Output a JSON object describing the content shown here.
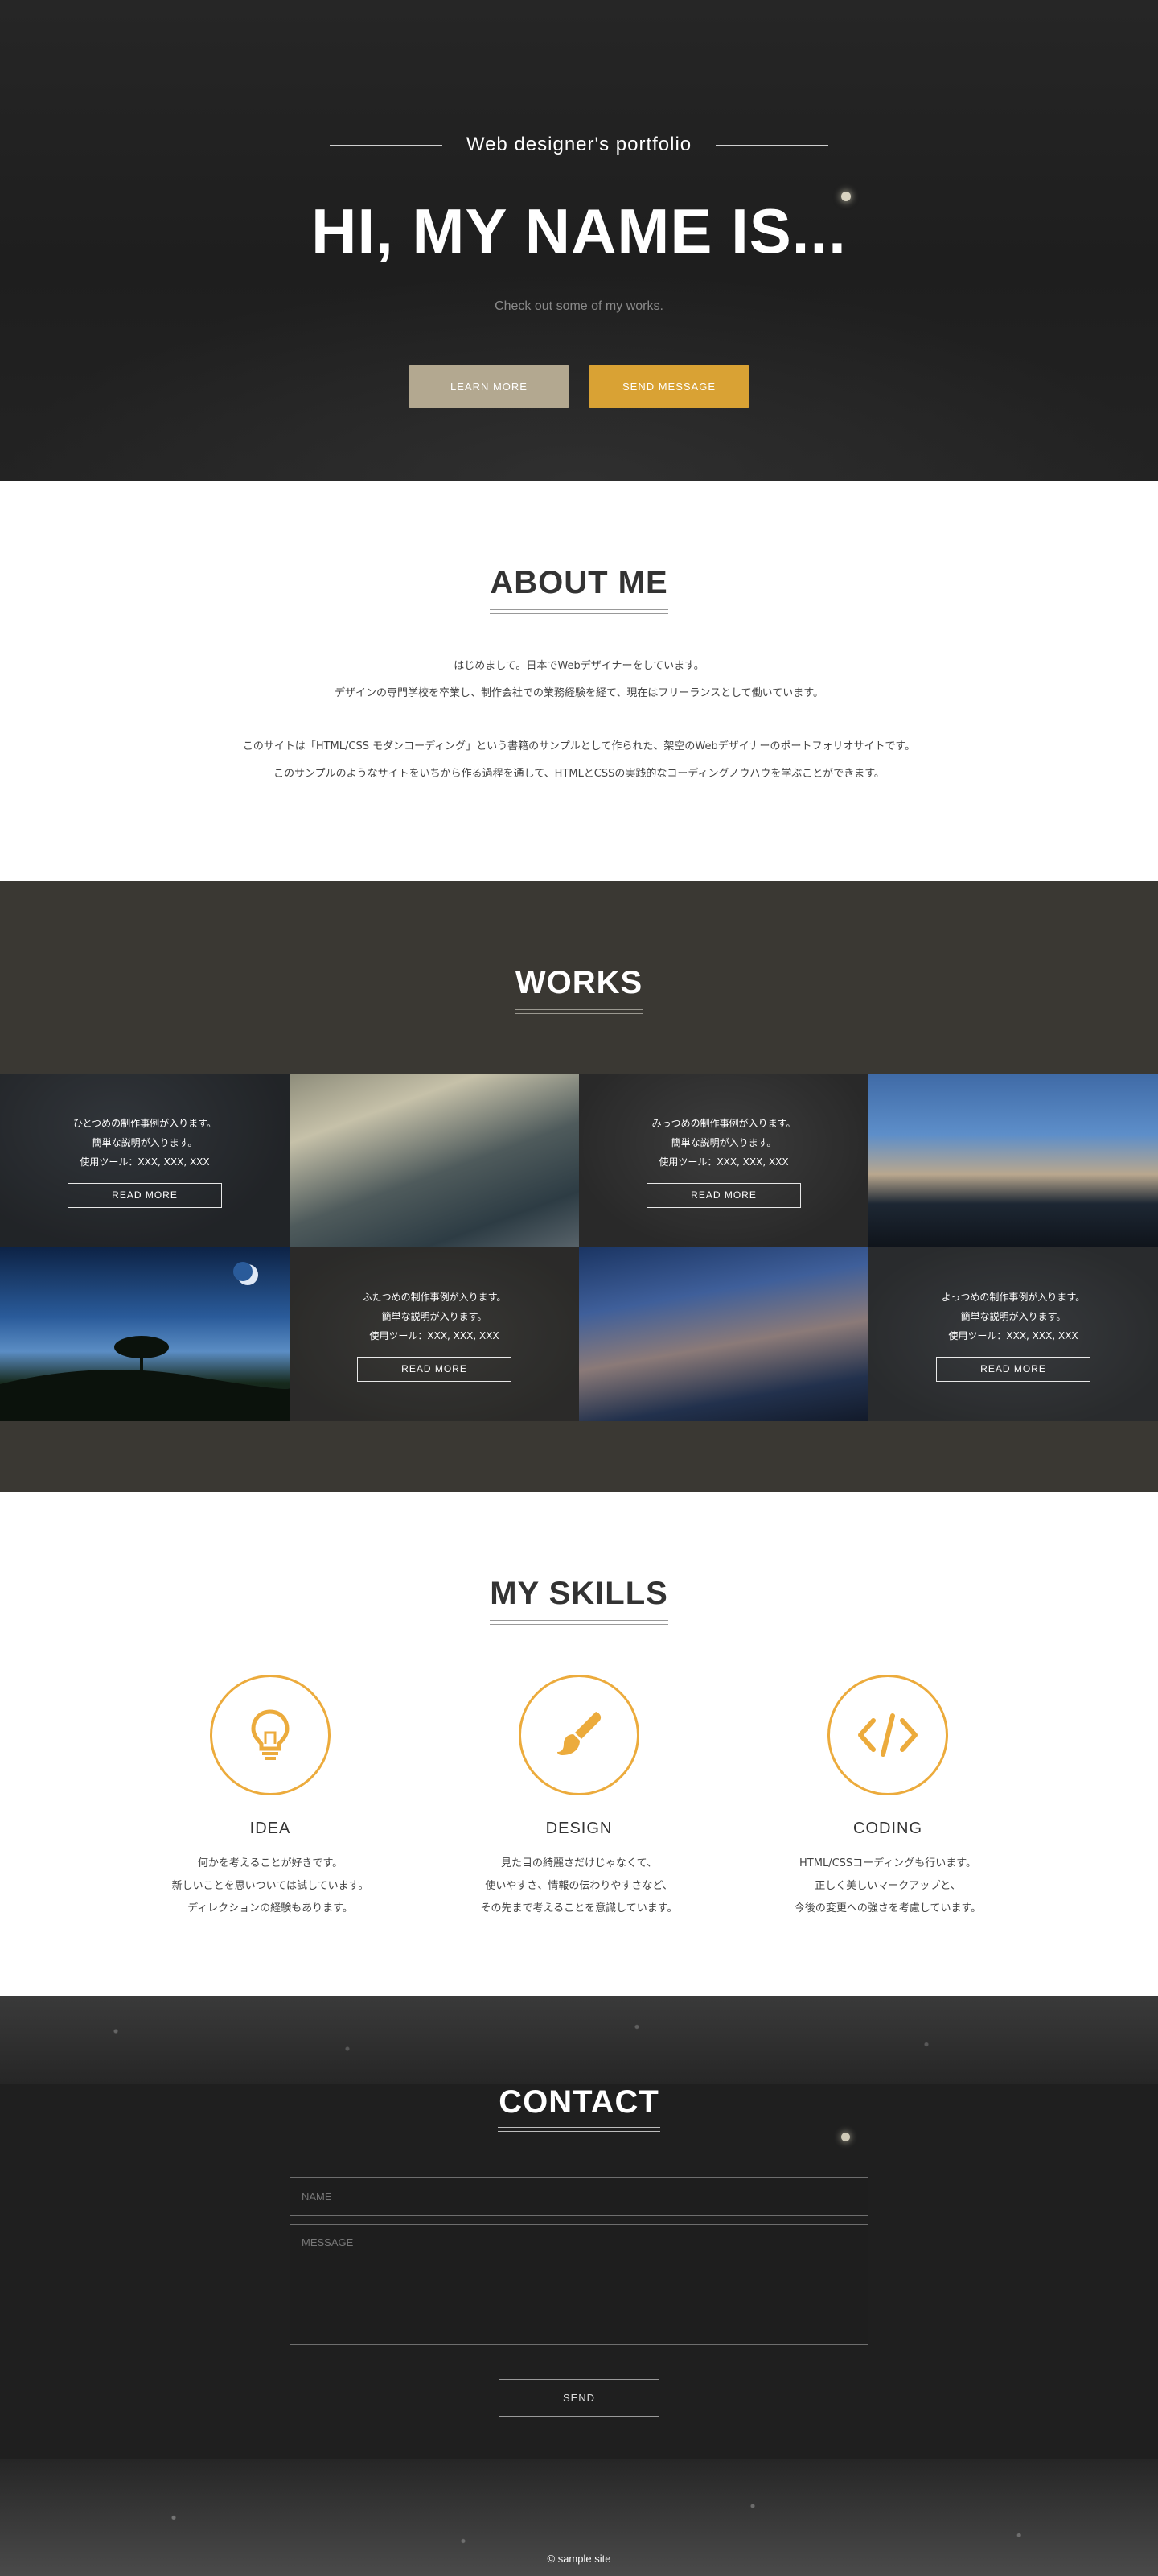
{
  "hero": {
    "subtitle": "Web designer's portfolio",
    "title": "HI, MY NAME IS...",
    "lead": "Check out some of my works.",
    "learn_more": "LEARN MORE",
    "send_message": "SEND MESSAGE"
  },
  "about": {
    "heading": "ABOUT ME",
    "lines": [
      "はじめまして。日本でWebデザイナーをしています。",
      "デザインの専門学校を卒業し、制作会社での業務経験を経て、現在はフリーランスとして働いています。",
      "このサイトは「HTML/CSS モダンコーディング」という書籍のサンプルとして作られた、架空のWebデザイナーのポートフォリオサイトです。",
      "このサンプルのようなサイトをいちから作る過程を通して、HTMLとCSSの実践的なコーディングノウハウを学ぶことができます。"
    ]
  },
  "works": {
    "heading": "WORKS",
    "read_more": "READ MORE",
    "items": [
      {
        "line1": "ひとつめの制作事例が入ります。",
        "line2": "簡単な説明が入ります。",
        "line3": "使用ツール：XXX, XXX, XXX"
      },
      {
        "line1": "ふたつめの制作事例が入ります。",
        "line2": "簡単な説明が入ります。",
        "line3": "使用ツール：XXX, XXX, XXX"
      },
      {
        "line1": "みっつめの制作事例が入ります。",
        "line2": "簡単な説明が入ります。",
        "line3": "使用ツール：XXX, XXX, XXX"
      },
      {
        "line1": "よっつめの制作事例が入ります。",
        "line2": "簡単な説明が入ります。",
        "line3": "使用ツール：XXX, XXX, XXX"
      }
    ]
  },
  "skills": {
    "heading": "MY SKILLS",
    "accent_color": "#ecab3c",
    "items": [
      {
        "icon": "lightbulb-icon",
        "title": "IDEA",
        "lines": [
          "何かを考えることが好きです。",
          "新しいことを思いついては試しています。",
          "ディレクションの経験もあります。"
        ]
      },
      {
        "icon": "paintbrush-icon",
        "title": "DESIGN",
        "lines": [
          "見た目の綺麗さだけじゃなくて、",
          "使いやすさ、情報の伝わりやすさなど、",
          "その先まで考えることを意識しています。"
        ]
      },
      {
        "icon": "code-icon",
        "title": "CODING",
        "lines": [
          "HTML/CSSコーディングも行います。",
          "正しく美しいマークアップと、",
          "今後の変更への強さを考慮しています。"
        ]
      }
    ]
  },
  "contact": {
    "heading": "CONTACT",
    "name_placeholder": "NAME",
    "message_placeholder": "MESSAGE",
    "send": "SEND"
  },
  "footer": {
    "copyright": "© sample site"
  }
}
